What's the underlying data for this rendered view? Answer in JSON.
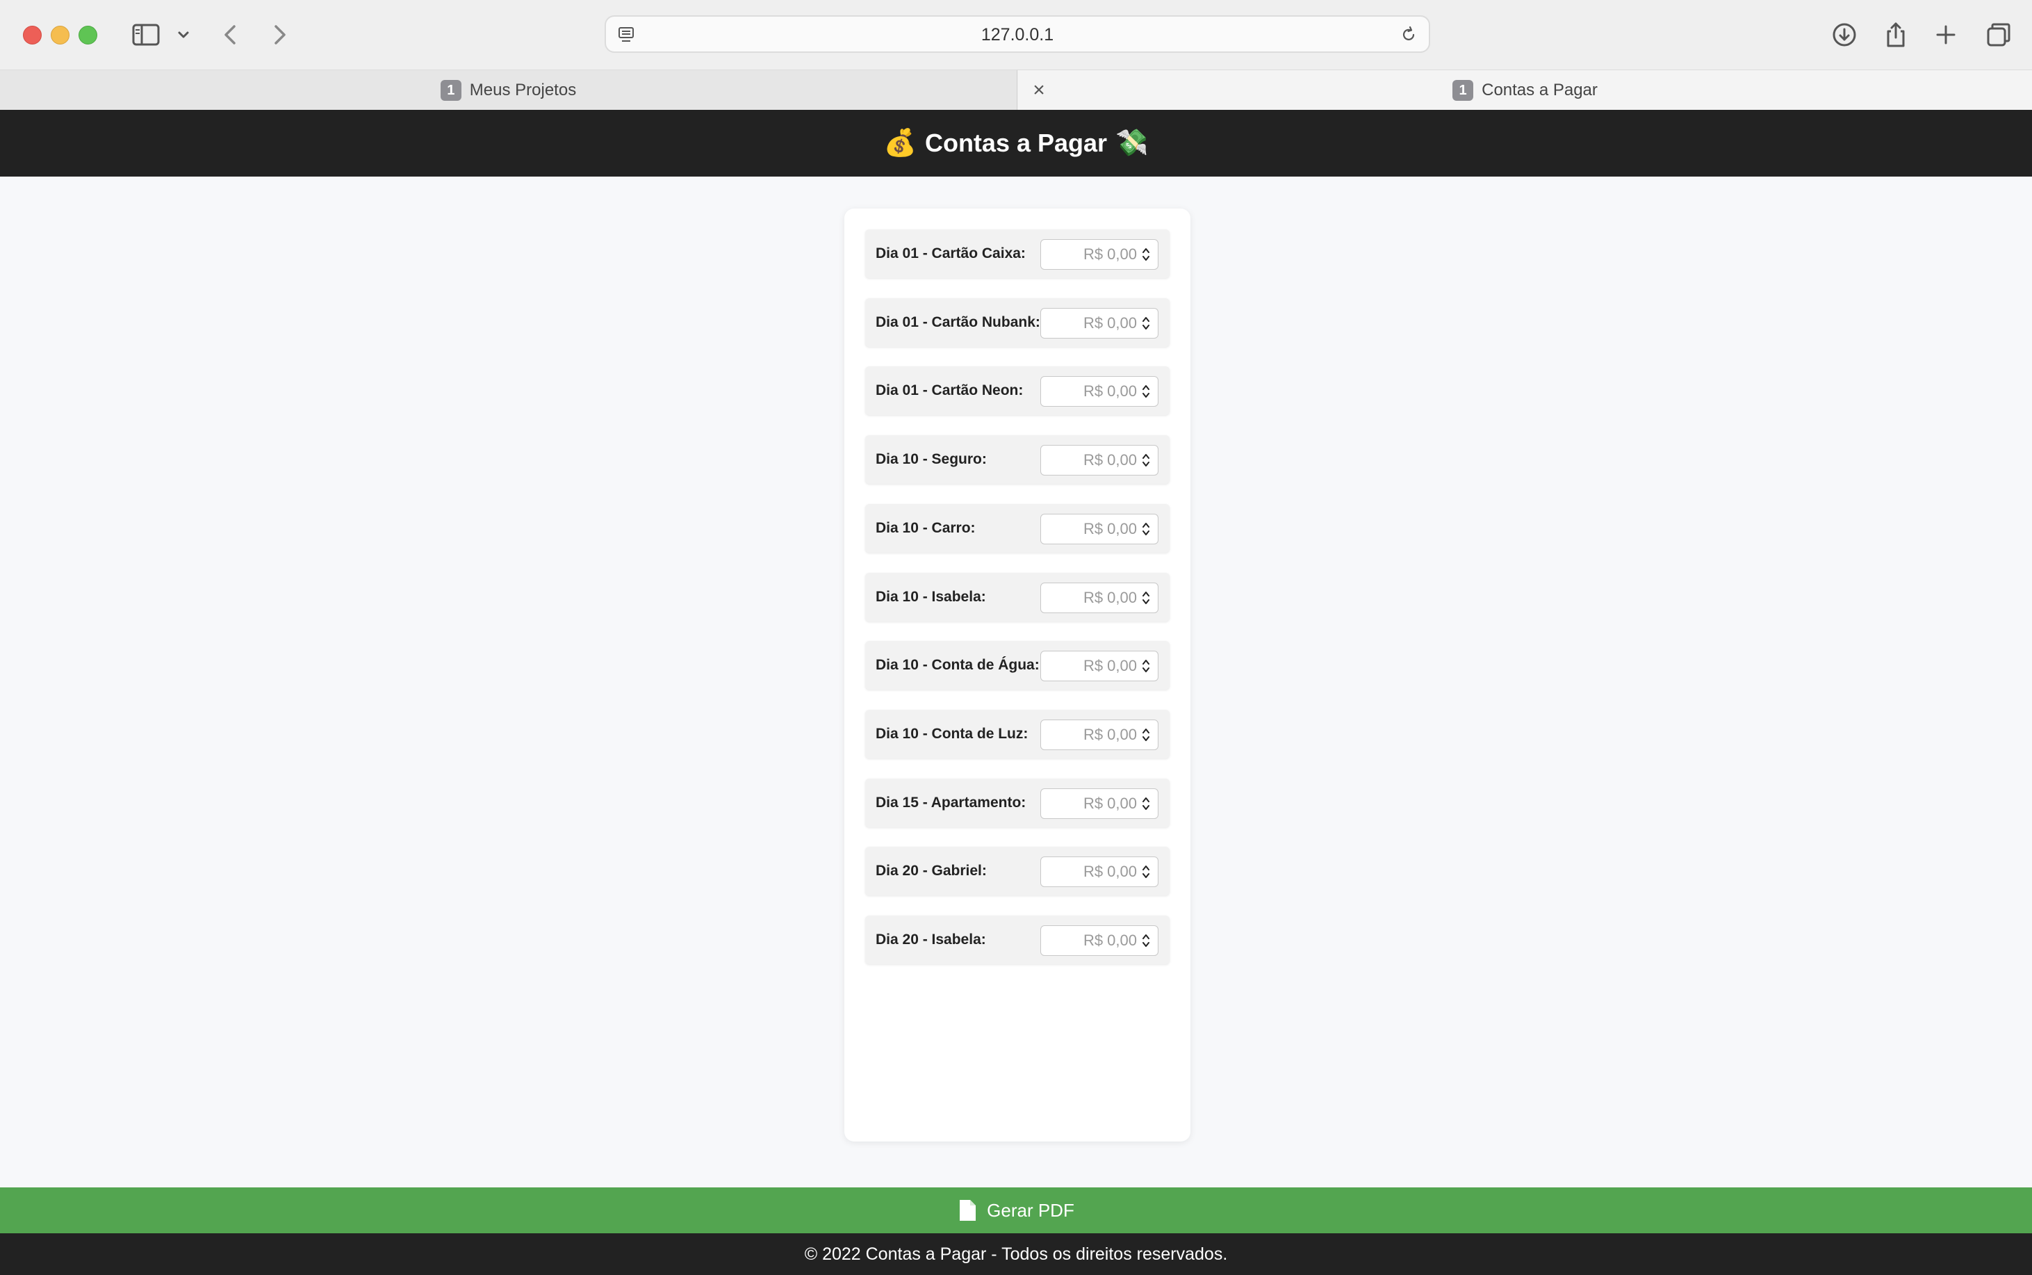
{
  "browser": {
    "url": "127.0.0.1",
    "tabs": [
      {
        "label": "Meus Projetos",
        "badge": "1",
        "active": false
      },
      {
        "label": "Contas a Pagar",
        "badge": "1",
        "active": true
      }
    ],
    "tab_close_glyph": "×",
    "icons": [
      "sidebar-icon",
      "chevron-down-icon",
      "back-icon",
      "forward-icon",
      "download-icon",
      "share-icon",
      "new-tab-icon",
      "tab-overview-icon",
      "reload-icon",
      "page-menu-icon"
    ]
  },
  "header": {
    "emoji_left": "💰",
    "title": "Contas a Pagar",
    "emoji_right": "💸"
  },
  "bills": [
    {
      "label": "Dia 01 - Cartão Caixa:",
      "placeholder": "R$ 0,00"
    },
    {
      "label": "Dia 01 - Cartão Nubank:",
      "placeholder": "R$ 0,00"
    },
    {
      "label": "Dia 01 - Cartão Neon:",
      "placeholder": "R$ 0,00"
    },
    {
      "label": "Dia 10 - Seguro:",
      "placeholder": "R$ 0,00"
    },
    {
      "label": "Dia 10 - Carro:",
      "placeholder": "R$ 0,00"
    },
    {
      "label": "Dia 10 - Isabela:",
      "placeholder": "R$ 0,00"
    },
    {
      "label": "Dia 10 - Conta de Água:",
      "placeholder": "R$ 0,00"
    },
    {
      "label": "Dia 10 - Conta de Luz:",
      "placeholder": "R$ 0,00"
    },
    {
      "label": "Dia 15 - Apartamento:",
      "placeholder": "R$ 0,00"
    },
    {
      "label": "Dia 20 - Gabriel:",
      "placeholder": "R$ 0,00"
    },
    {
      "label": "Dia 20 - Isabela:",
      "placeholder": "R$ 0,00"
    }
  ],
  "actions": {
    "pdf_label": "Gerar PDF",
    "pdf_icon": "document-icon"
  },
  "footer": {
    "text": "© 2022 Contas a Pagar - Todos os direitos reservados."
  },
  "colors": {
    "header_bg": "#222222",
    "button_bg": "#53a550",
    "page_bg": "#f7f8fa"
  }
}
